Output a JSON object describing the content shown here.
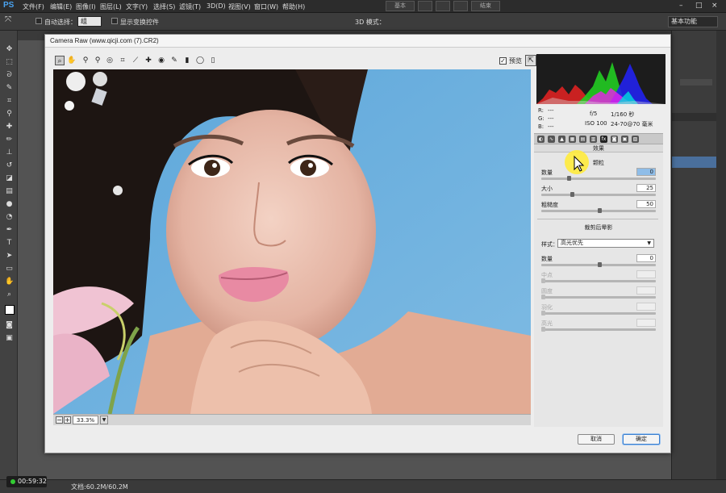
{
  "app": {
    "logo": "PS",
    "menu": [
      "文件(F)",
      "编辑(E)",
      "图像(I)",
      "图层(L)",
      "文字(Y)",
      "选择(S)",
      "滤镜(T)",
      "3D(D)",
      "视图(V)",
      "窗口(W)",
      "帮助(H)"
    ],
    "ws_tabs": [
      "基本",
      "结束"
    ],
    "window_controls": [
      "–",
      "□",
      "×"
    ]
  },
  "options": {
    "auto_select_label": "自动选择：",
    "auto_select_value": "组",
    "show_transform_label": "显示变换控件",
    "mode_3d_label": "3D 模式：",
    "workspace": "基本功能"
  },
  "status": {
    "timer": "00:59:32",
    "doc_size": "文档:60.2M/60.2M"
  },
  "dialog": {
    "title": "Camera Raw (www.qicji.com (7).CR2)",
    "preview_label": "预览",
    "preview_checked": true,
    "zoom": "33.3%",
    "cancel_label": "取消",
    "ok_label": "确定"
  },
  "camera_info": {
    "r_label": "R:",
    "g_label": "G:",
    "b_label": "B:",
    "rgb_value": "---",
    "aperture": "f/5",
    "shutter": "1/160 秒",
    "iso": "ISO 100",
    "lens": "24-70@70 毫米"
  },
  "panel": {
    "title": "效果",
    "grain": {
      "title": "颗粒",
      "amount_label": "数量",
      "amount_value": "0",
      "size_label": "大小",
      "size_value": "25",
      "roughness_label": "粗糙度",
      "roughness_value": "50"
    },
    "vignette": {
      "title": "裁剪后晕影",
      "style_label": "样式：",
      "style_value": "高光优先",
      "amount_label": "数量",
      "amount_value": "0",
      "midpoint_label": "中点",
      "roundness_label": "圆度",
      "feather_label": "羽化",
      "highlights_label": "高光"
    }
  },
  "colors": {
    "ps_dark": "#2c2c2c",
    "dialog_bg": "#ededed",
    "sky": "#6fb0dd",
    "accent_blue": "#3b7fd0"
  }
}
